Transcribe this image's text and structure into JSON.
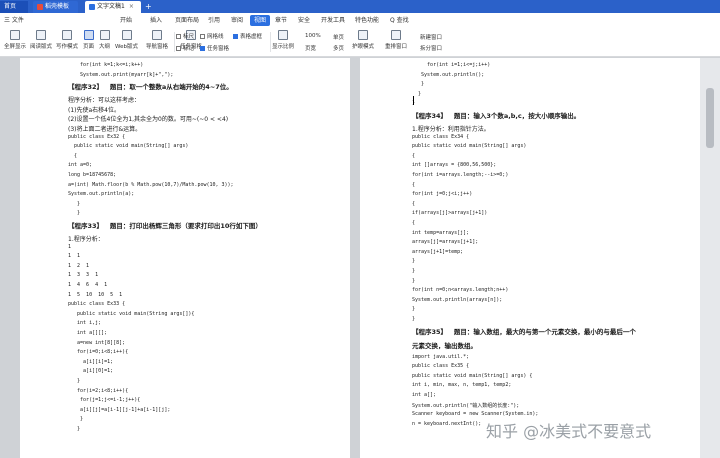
{
  "tabs": [
    {
      "label": "首页"
    },
    {
      "label": "稻壳模板"
    },
    {
      "label": "文字文稿1"
    }
  ],
  "menus": [
    {
      "label": "三 文件"
    },
    {
      "label": "开始"
    },
    {
      "label": "插入"
    },
    {
      "label": "页面布局"
    },
    {
      "label": "引用"
    },
    {
      "label": "审阅"
    },
    {
      "label": "视图"
    },
    {
      "label": "章节"
    },
    {
      "label": "安全"
    },
    {
      "label": "开发工具"
    },
    {
      "label": "特色功能"
    },
    {
      "label": "Q 查找"
    }
  ],
  "toolbar": {
    "buttons": [
      "全屏显示",
      "阅读版式",
      "写作模式",
      "页面",
      "大纲",
      "Web版式",
      "导航窗格",
      "任务窗格"
    ],
    "checks": [
      "标尺",
      "网格线",
      "表格虚框",
      "标记",
      "任务窗格"
    ],
    "right": [
      "显示比例",
      "100%",
      "页宽",
      "单页",
      "多页",
      "护眼模式",
      "重排窗口",
      "新建窗口",
      "拆分窗口"
    ]
  },
  "left_page": [
    {
      "text": "    for(int k=1;k<=i;k++)",
      "cls": ""
    },
    {
      "text": "    System.out.print(myarr[k]+\",\");",
      "cls": ""
    },
    {
      "text": "【程序32】   题目：取一个整数a从右端开始的4~7位。",
      "cls": "head"
    },
    {
      "text": "程序分析：可以这样考虑：",
      "cls": "cn"
    },
    {
      "text": "(1)先使a右移4位。",
      "cls": "cn"
    },
    {
      "text": "(2)设置一个低4位全为1,其余全为0的数。可用~(~0 < <4)",
      "cls": "cn"
    },
    {
      "text": "(3)将上面二者进行&运算。",
      "cls": "cn"
    },
    {
      "text": "public class Ex32 {",
      "cls": ""
    },
    {
      "text": "  public static void main(String[] args)",
      "cls": ""
    },
    {
      "text": "  {",
      "cls": ""
    },
    {
      "text": "int a=0;",
      "cls": ""
    },
    {
      "text": "long b=18745678;",
      "cls": ""
    },
    {
      "text": "a=(int) Math.floor(b % Math.pow(10,7)/Math.pow(10, 3));",
      "cls": ""
    },
    {
      "text": "System.out.println(a);",
      "cls": ""
    },
    {
      "text": "   }",
      "cls": ""
    },
    {
      "text": "   }",
      "cls": ""
    },
    {
      "text": "【程序33】   题目：打印出杨辉三角形（要求打印出10行如下图）",
      "cls": "head"
    },
    {
      "text": "1.程序分析：",
      "cls": "cn"
    },
    {
      "text": "1",
      "cls": ""
    },
    {
      "text": "1  1",
      "cls": ""
    },
    {
      "text": "1  2  1",
      "cls": ""
    },
    {
      "text": "1  3  3  1",
      "cls": ""
    },
    {
      "text": "1  4  6  4  1",
      "cls": ""
    },
    {
      "text": "1  5  10  10  5  1",
      "cls": ""
    },
    {
      "text": "public class Ex33 {",
      "cls": ""
    },
    {
      "text": "   public static void main(String args[]){",
      "cls": ""
    },
    {
      "text": "   int i,j;",
      "cls": ""
    },
    {
      "text": "   int a[][];",
      "cls": ""
    },
    {
      "text": "   a=new int[8][8];",
      "cls": ""
    },
    {
      "text": "   for(i=0;i<8;i++){",
      "cls": ""
    },
    {
      "text": "     a[i][i]=1;",
      "cls": ""
    },
    {
      "text": "     a[i][0]=1;",
      "cls": ""
    },
    {
      "text": "   }",
      "cls": ""
    },
    {
      "text": "   for(i=2;i<8;i++){",
      "cls": ""
    },
    {
      "text": "    for(j=1;j<=i-1;j++){",
      "cls": ""
    },
    {
      "text": "    a[i][j]=a[i-1][j-1]+a[i-1][j];",
      "cls": ""
    },
    {
      "text": "    }",
      "cls": ""
    },
    {
      "text": "   }",
      "cls": ""
    }
  ],
  "right_page": [
    {
      "text": "     for(int i=1;i<=j;i++)",
      "cls": ""
    },
    {
      "text": "   System.out.println();",
      "cls": ""
    },
    {
      "text": "   }",
      "cls": ""
    },
    {
      "text": "  }",
      "cls": ""
    },
    {
      "text": "}",
      "cls": ""
    },
    {
      "text": "【程序34】   题目：输入3个数a,b,c，按大小顺序输出。",
      "cls": "head"
    },
    {
      "text": "1.程序分析：利用指针方法。",
      "cls": "cn"
    },
    {
      "text": "public class Ex34 {",
      "cls": ""
    },
    {
      "text": "public static void main(String[] args)",
      "cls": ""
    },
    {
      "text": "{",
      "cls": ""
    },
    {
      "text": "int []arrays = {800,56,500};",
      "cls": ""
    },
    {
      "text": "for(int i=arrays.length;--i>=0;)",
      "cls": ""
    },
    {
      "text": "{",
      "cls": ""
    },
    {
      "text": "for(int j=0;j<i;j++)",
      "cls": ""
    },
    {
      "text": "{",
      "cls": ""
    },
    {
      "text": "if(arrays[j]>arrays[j+1])",
      "cls": ""
    },
    {
      "text": "{",
      "cls": ""
    },
    {
      "text": "int temp=arrays[j];",
      "cls": ""
    },
    {
      "text": "arrays[j]=arrays[j+1];",
      "cls": ""
    },
    {
      "text": "arrays[j+1]=temp;",
      "cls": ""
    },
    {
      "text": "}",
      "cls": ""
    },
    {
      "text": "}",
      "cls": ""
    },
    {
      "text": "}",
      "cls": ""
    },
    {
      "text": "for(int n=0;n<arrays.length;n++)",
      "cls": ""
    },
    {
      "text": "System.out.println(arrays[n]);",
      "cls": ""
    },
    {
      "text": "}",
      "cls": ""
    },
    {
      "text": "}",
      "cls": ""
    },
    {
      "text": "【程序35】   题目：输入数组，最大的与第一个元素交换，最小的与最后一个",
      "cls": "head"
    },
    {
      "text": "元素交换，输出数组。",
      "cls": "head"
    },
    {
      "text": "import java.util.*;",
      "cls": ""
    },
    {
      "text": "public class Ex35 {",
      "cls": ""
    },
    {
      "text": "public static void main(String[] args) {",
      "cls": ""
    },
    {
      "text": "int i, min, max, n, temp1, temp2;",
      "cls": ""
    },
    {
      "text": "int a[];",
      "cls": ""
    },
    {
      "text": "System.out.println(\"输入数组的长度:\");",
      "cls": ""
    },
    {
      "text": "Scanner keyboard = new Scanner(System.in);",
      "cls": ""
    },
    {
      "text": "n = keyboard.nextInt();",
      "cls": ""
    }
  ],
  "watermark": "知乎 @冰美式不要意式"
}
